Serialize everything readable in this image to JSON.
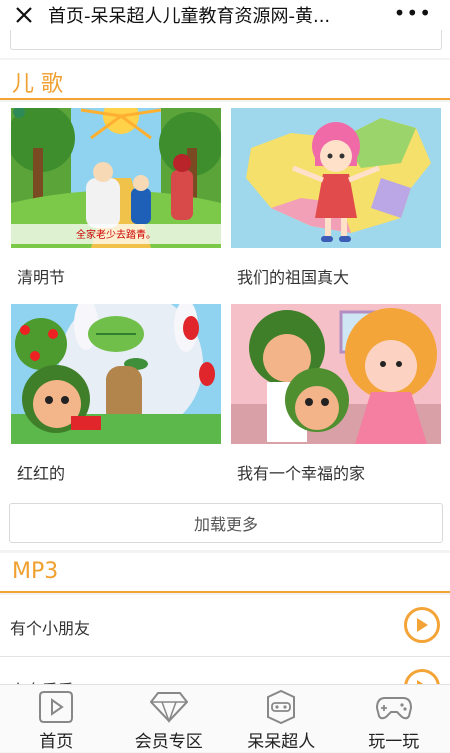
{
  "titlebar": {
    "title": "首页-呆呆超人儿童教育资源网-黄...",
    "more": "•••"
  },
  "sections": {
    "songs_title": "儿 歌",
    "mp3_title": "MP3"
  },
  "cards": [
    {
      "label": "清明节",
      "caption": "全家老少去踏青。"
    },
    {
      "label": "我们的祖国真大"
    },
    {
      "label": "红红的"
    },
    {
      "label": "我有一个幸福的家"
    }
  ],
  "load_more": "加载更多",
  "mp3_items": [
    {
      "name": "有个小朋友"
    },
    {
      "name": "小鸟乖乖"
    }
  ],
  "tabs": [
    {
      "label": "首页",
      "icon": "play-icon"
    },
    {
      "label": "会员专区",
      "icon": "diamond-icon"
    },
    {
      "label": "呆呆超人",
      "icon": "robot-icon"
    },
    {
      "label": "玩一玩",
      "icon": "gamepad-icon"
    }
  ],
  "colors": {
    "accent": "#f4a436",
    "section_text": "#f0a030"
  }
}
